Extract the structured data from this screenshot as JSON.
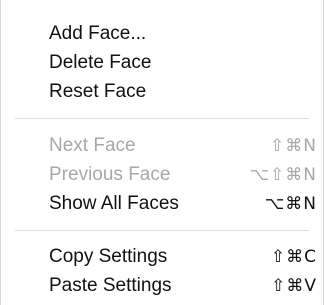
{
  "menu": {
    "items": [
      {
        "label": "Add Face...",
        "shortcut": "",
        "enabled": true
      },
      {
        "label": "Delete Face",
        "shortcut": "",
        "enabled": true
      },
      {
        "label": "Reset Face",
        "shortcut": "",
        "enabled": true
      },
      {
        "label": "Next Face",
        "shortcut": "⇧⌘N",
        "enabled": false
      },
      {
        "label": "Previous Face",
        "shortcut": "⌥⇧⌘N",
        "enabled": false
      },
      {
        "label": "Show All Faces",
        "shortcut": "⌥⌘N",
        "enabled": true
      },
      {
        "label": "Copy Settings",
        "shortcut": "⇧⌘C",
        "enabled": true
      },
      {
        "label": "Paste Settings",
        "shortcut": "⇧⌘V",
        "enabled": true
      }
    ]
  }
}
